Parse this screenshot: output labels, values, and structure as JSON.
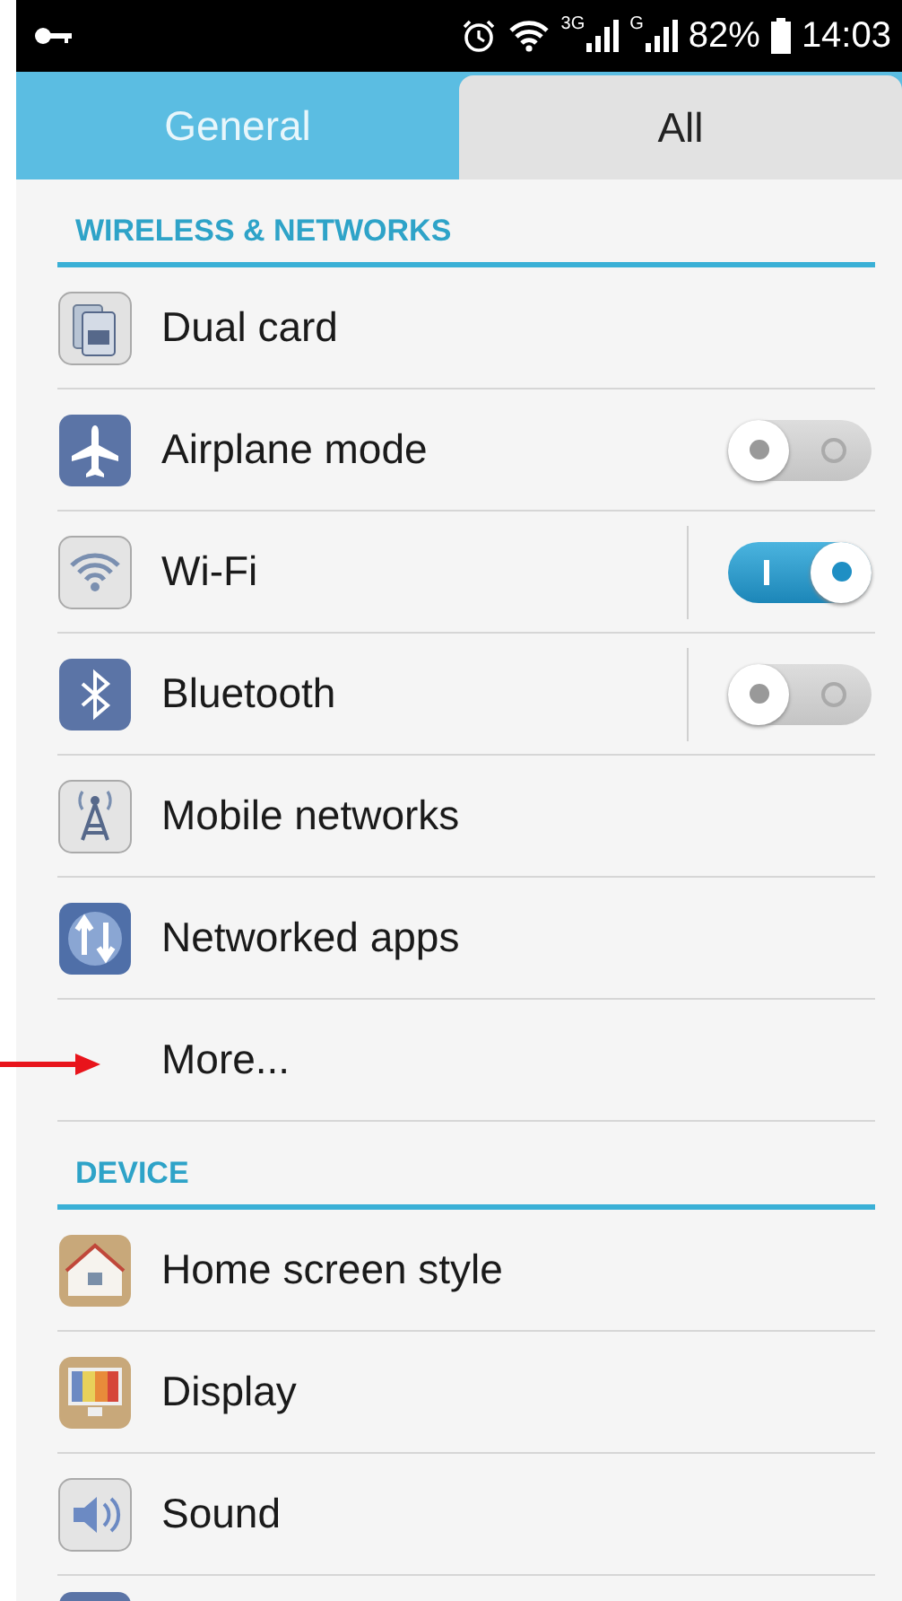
{
  "status_bar": {
    "network_labels": [
      "3G",
      "G"
    ],
    "battery": "82%",
    "time": "14:03"
  },
  "tabs": [
    {
      "label": "General",
      "selected": true
    },
    {
      "label": "All",
      "selected": false
    }
  ],
  "sections": [
    {
      "header": "WIRELESS & NETWORKS",
      "items": [
        {
          "label": "Dual card",
          "kind": "plain"
        },
        {
          "label": "Airplane mode",
          "kind": "switch",
          "on": false,
          "divider": false
        },
        {
          "label": "Wi-Fi",
          "kind": "switch",
          "on": true,
          "divider": true
        },
        {
          "label": "Bluetooth",
          "kind": "switch",
          "on": false,
          "divider": true
        },
        {
          "label": "Mobile networks",
          "kind": "plain"
        },
        {
          "label": "Networked apps",
          "kind": "plain"
        },
        {
          "label": "More...",
          "kind": "plain"
        }
      ]
    },
    {
      "header": "DEVICE",
      "items": [
        {
          "label": "Home screen style",
          "kind": "plain"
        },
        {
          "label": "Display",
          "kind": "plain"
        },
        {
          "label": "Sound",
          "kind": "plain"
        }
      ]
    }
  ]
}
